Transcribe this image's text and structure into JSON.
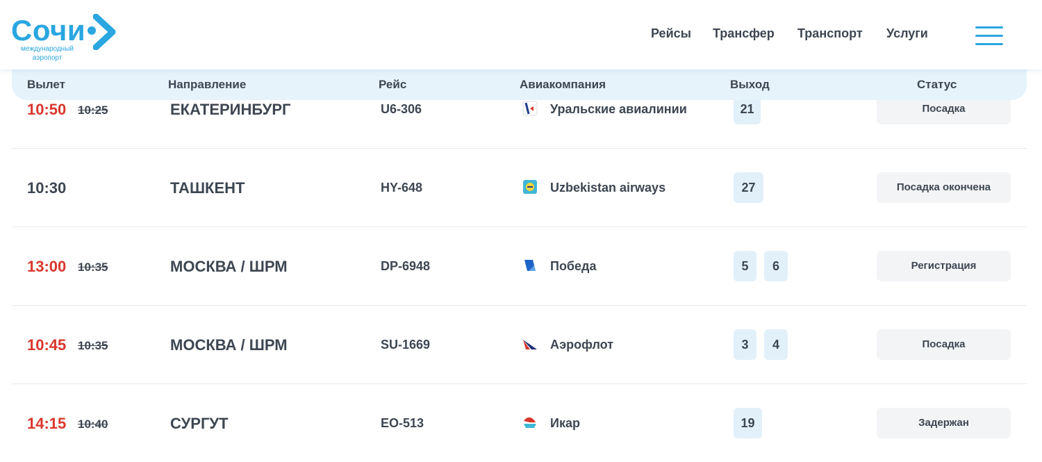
{
  "logo": {
    "word": "Сочи",
    "subtitle_line1": "международный",
    "subtitle_line2": "аэропорт"
  },
  "nav": {
    "items": [
      "Рейсы",
      "Трансфер",
      "Транспорт",
      "Услуги"
    ]
  },
  "table": {
    "columns": [
      "Вылет",
      "Направление",
      "Рейс",
      "Авиакомпания",
      "Выход",
      "Статус"
    ],
    "rows": [
      {
        "time": "10:50",
        "scheduled": "10:25",
        "delayed": true,
        "destination": "ЕКАТЕРИНБУРГ",
        "flight": "U6-306",
        "airline": "Уральские авиалинии",
        "airline_icon": "ural-airlines-icon",
        "gates": [
          "21"
        ],
        "status": "Посадка"
      },
      {
        "time": "10:30",
        "scheduled": "",
        "delayed": false,
        "destination": "ТАШКЕНТ",
        "flight": "HY-648",
        "airline": "Uzbekistan airways",
        "airline_icon": "uzbekistan-airways-icon",
        "gates": [
          "27"
        ],
        "status": "Посадка окончена"
      },
      {
        "time": "13:00",
        "scheduled": "10:35",
        "delayed": true,
        "destination": "МОСКВА / ШРМ",
        "flight": "DP-6948",
        "airline": "Победа",
        "airline_icon": "pobeda-icon",
        "gates": [
          "5",
          "6"
        ],
        "status": "Регистрация"
      },
      {
        "time": "10:45",
        "scheduled": "10:35",
        "delayed": true,
        "destination": "МОСКВА / ШРМ",
        "flight": "SU-1669",
        "airline": "Аэрофлот",
        "airline_icon": "aeroflot-icon",
        "gates": [
          "3",
          "4"
        ],
        "status": "Посадка"
      },
      {
        "time": "14:15",
        "scheduled": "10:40",
        "delayed": true,
        "destination": "СУРГУТ",
        "flight": "EO-513",
        "airline": "Икар",
        "airline_icon": "ikar-icon",
        "gates": [
          "19"
        ],
        "status": "Задержан"
      }
    ]
  },
  "colors": {
    "accent": "#2aa6e0",
    "delay_red": "#d9362b",
    "text": "#3d4652",
    "header_bg": "#e6f3fb",
    "gate_bg": "#e2f0fa",
    "status_bg": "#f2f4f6"
  }
}
